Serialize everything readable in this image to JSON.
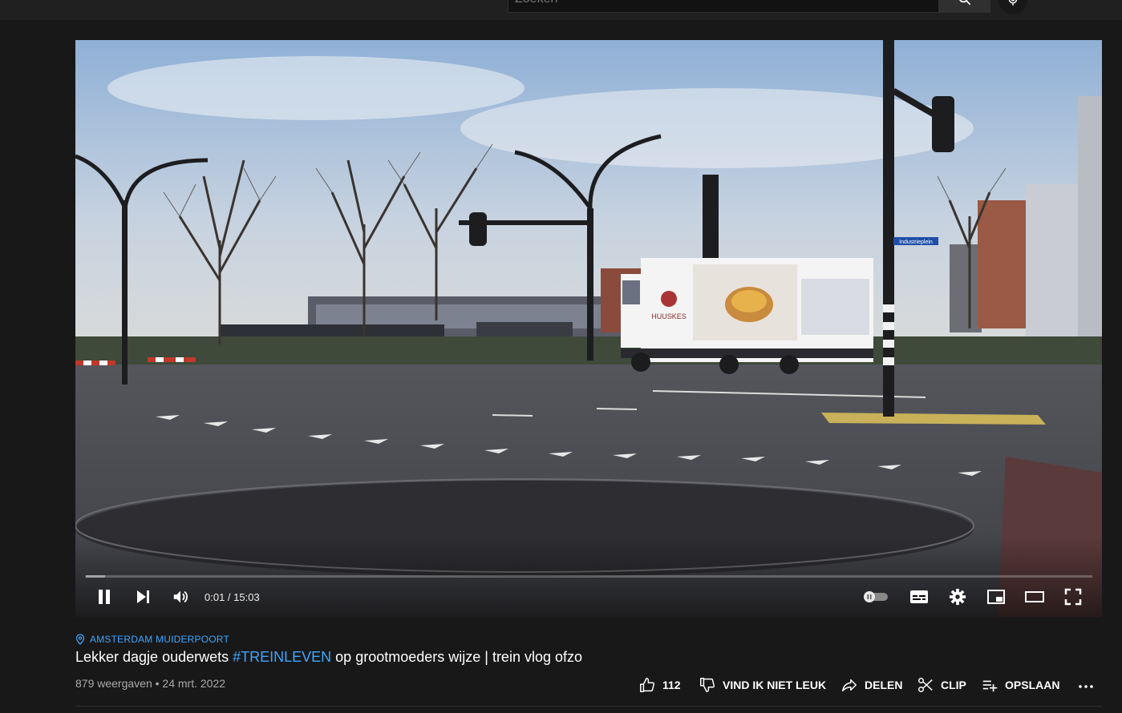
{
  "search": {
    "placeholder": "Zoeken"
  },
  "player": {
    "time_current": "0:01",
    "time_total": "15:03",
    "time_separator": " / ",
    "progress_fraction": 0.001,
    "buffer_fraction": 0.02
  },
  "scene_text": {
    "truck_brand": "HUUSKES",
    "street_sign": "Industrieplein"
  },
  "video": {
    "location": "AMSTERDAM MUIDERPOORT",
    "title_pre": "Lekker dagje ouderwets ",
    "title_tag": "#TREINLEVEN",
    "title_post": " op grootmoeders wijze | trein vlog ofzo",
    "meta": "879 weergaven • 24 mrt. 2022"
  },
  "actions": {
    "likes": "112",
    "dislike": "VIND IK NIET LEUK",
    "share": "DELEN",
    "clip": "CLIP",
    "save": "OPSLAAN"
  },
  "colors": {
    "accent": "#3ea6ff",
    "progress": "#ff0000",
    "background": "#181818"
  }
}
